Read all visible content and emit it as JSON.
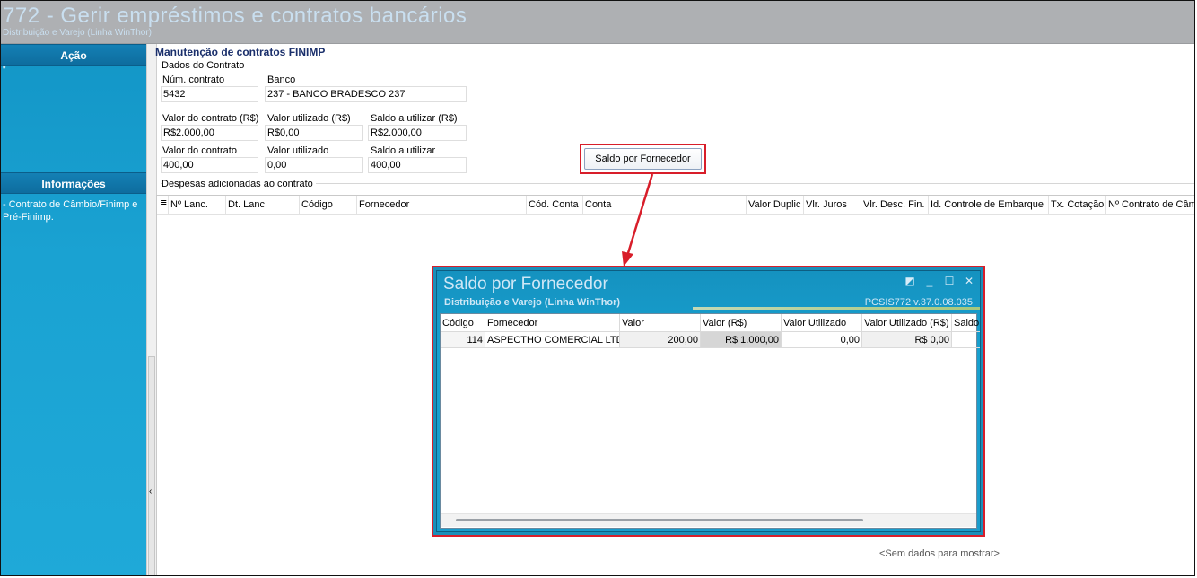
{
  "window": {
    "title": "772 - Gerir empréstimos e contratos bancários",
    "subtitle": "Distribuição e Varejo (Linha WinThor)"
  },
  "sidebar": {
    "acao_header": "Ação",
    "acao_mark": "\"",
    "info_header": "Informações",
    "info_text": "- Contrato de Câmbio/Finimp e Pré-Finimp."
  },
  "main": {
    "title": "Manutenção de contratos FINIMP",
    "dados_group": "Dados do Contrato",
    "num_contrato": {
      "label": "Núm. contrato",
      "value": "5432"
    },
    "banco": {
      "label": "Banco",
      "value": "237 - BANCO BRADESCO 237"
    },
    "valor_contrato_rs": {
      "label": "Valor do contrato (R$)",
      "value": "R$2.000,00"
    },
    "valor_utilizado_rs": {
      "label": "Valor utilizado (R$)",
      "value": "R$0,00"
    },
    "saldo_utilizar_rs": {
      "label": "Saldo a utilizar (R$)",
      "value": "R$2.000,00"
    },
    "valor_contrato": {
      "label": "Valor do contrato",
      "value": "400,00"
    },
    "valor_utilizado": {
      "label": "Valor utilizado",
      "value": "0,00"
    },
    "saldo_utilizar": {
      "label": "Saldo a utilizar",
      "value": "400,00"
    },
    "saldo_button": "Saldo por Fornecedor",
    "despesas_group": "Despesas adicionadas ao contrato",
    "grid_icon": "grid-menu-icon",
    "grid_columns": [
      "Nº Lanc.",
      "Dt. Lanc",
      "Código",
      "Fornecedor",
      "Cód. Conta",
      "Conta",
      "Valor Duplic",
      "Vlr. Juros",
      "Vlr. Desc. Fin.",
      "Id. Controle de Embarque",
      "Tx. Cotação",
      "Nº Contrato de Câmbio"
    ],
    "no_data": "<Sem dados para mostrar>"
  },
  "popup": {
    "title": "Saldo por Fornecedor",
    "subtitle": "Distribuição e Varejo (Linha WinThor)",
    "version": "PCSIS772  v.37.0.08.035",
    "columns": [
      "Código",
      "Fornecedor",
      "Valor",
      "Valor (R$)",
      "Valor Utilizado",
      "Valor Utilizado (R$)",
      "Saldo"
    ],
    "rows": [
      [
        "114",
        "ASPECTHO COMERCIAL LTDA",
        "200,00",
        "R$ 1.000,00",
        "0,00",
        "R$ 0,00",
        ""
      ]
    ]
  },
  "colors": {
    "accent_blue": "#1aa2d2",
    "highlight_red": "#d81e2a",
    "title_navy": "#1a2f6b"
  }
}
